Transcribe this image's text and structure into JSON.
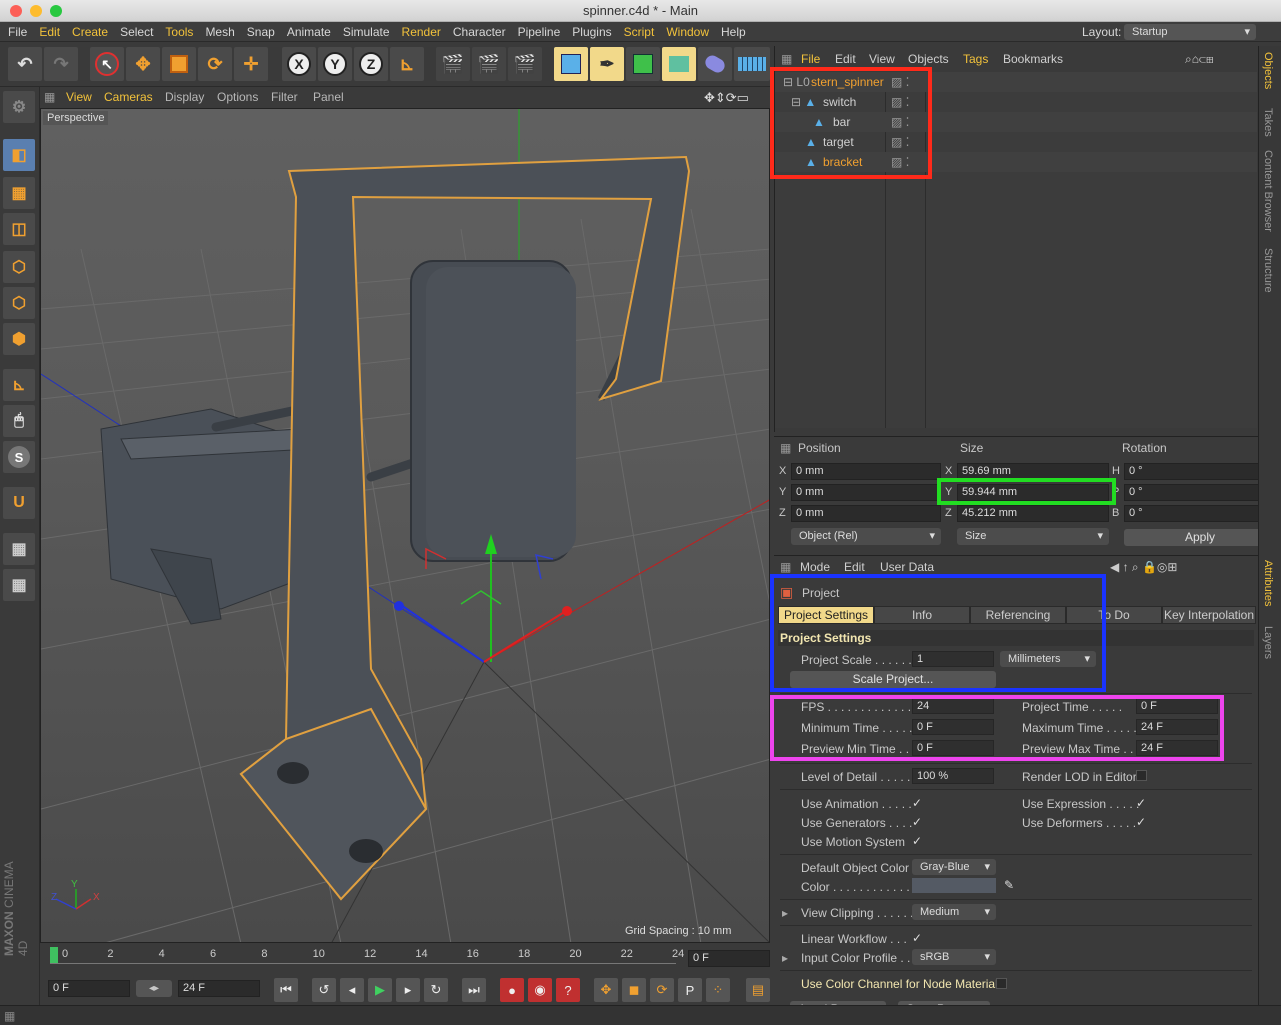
{
  "window": {
    "title": "spinner.c4d * - Main"
  },
  "menubar": {
    "items": [
      "File",
      "Edit",
      "Create",
      "Select",
      "Tools",
      "Mesh",
      "Snap",
      "Animate",
      "Simulate",
      "Render",
      "Character",
      "Pipeline",
      "Plugins",
      "Script",
      "Window",
      "Help"
    ],
    "layout_label": "Layout:",
    "layout_value": "Startup"
  },
  "viewport": {
    "menu": [
      "View",
      "Cameras",
      "Display",
      "Options",
      "Filter",
      "Panel"
    ],
    "camera_label": "Perspective",
    "grid_spacing": "Grid Spacing : 10 mm",
    "axis_x": "X",
    "axis_y": "Y",
    "axis_z": "Z"
  },
  "branding": {
    "maxon": "MAXON",
    "cinema": "CINEMA 4D"
  },
  "timeline": {
    "ticks": [
      "0",
      "2",
      "4",
      "6",
      "8",
      "10",
      "12",
      "14",
      "16",
      "18",
      "20",
      "22",
      "24"
    ],
    "current_frame": "0 F"
  },
  "transport": {
    "start_field": "0 F",
    "end_field": "24 F"
  },
  "objects_panel": {
    "menu": [
      "File",
      "Edit",
      "View",
      "Objects",
      "Tags",
      "Bookmarks"
    ],
    "items": [
      {
        "name": "stern_spinner",
        "indent": 0
      },
      {
        "name": "switch",
        "indent": 1
      },
      {
        "name": "bar",
        "indent": 2
      },
      {
        "name": "target",
        "indent": 1
      },
      {
        "name": "bracket",
        "indent": 1
      }
    ]
  },
  "coordinates": {
    "headers": {
      "position": "Position",
      "size": "Size",
      "rotation": "Rotation"
    },
    "position": {
      "x": "0 mm",
      "y": "0 mm",
      "z": "0 mm"
    },
    "size": {
      "x": "59.69 mm",
      "y": "59.944 mm",
      "z": "45.212 mm"
    },
    "rotation": {
      "h": "0 °",
      "p": "0 °",
      "b": "0 °"
    },
    "labels": {
      "x": "X",
      "y": "Y",
      "z": "Z",
      "h": "H",
      "p": "P",
      "b": "B"
    },
    "mode_dropdown": "Object (Rel)",
    "size_dropdown": "Size",
    "apply_label": "Apply"
  },
  "attributes": {
    "menu": [
      "Mode",
      "Edit",
      "User Data"
    ],
    "object_label": "Project",
    "tabs": [
      "Project Settings",
      "Info",
      "Referencing",
      "To Do",
      "Key Interpolation"
    ],
    "section_title": "Project Settings",
    "project_scale_label": "Project Scale . . . . . .",
    "project_scale_value": "1",
    "project_scale_unit": "Millimeters",
    "scale_project_button": "Scale Project...",
    "fps_label": "FPS . . . . . . . . . . . . . .",
    "fps_value": "24",
    "project_time_label": "Project Time . . . . .",
    "project_time_value": "0 F",
    "min_time_label": "Minimum Time . . . . .",
    "min_time_value": "0 F",
    "max_time_label": "Maximum Time . . . . .",
    "max_time_value": "24 F",
    "preview_min_label": "Preview Min Time . .",
    "preview_min_value": "0 F",
    "preview_max_label": "Preview Max Time . . .",
    "preview_max_value": "24 F",
    "lod_label": "Level of Detail . . . . .",
    "lod_value": "100 %",
    "render_lod_label": "Render LOD in Editor",
    "use_animation_label": "Use Animation . . . . .",
    "use_expression_label": "Use Expression . . . . .",
    "use_generators_label": "Use Generators . . . .",
    "use_deformers_label": "Use Deformers . . . . .",
    "use_motion_label": "Use Motion System",
    "default_color_label": "Default Object Color",
    "default_color_value": "Gray-Blue",
    "color_label": "Color . . . . . . . . . . . .",
    "view_clipping_label": "View Clipping . . . . . .",
    "view_clipping_value": "Medium",
    "linear_workflow_label": "Linear Workflow . . .",
    "input_color_label": "Input Color Profile . .",
    "input_color_value": "sRGB",
    "node_material_label": "Use Color Channel for Node Material",
    "load_preset": "Load Preset...",
    "save_preset": "Save Preset..."
  },
  "right_tabs": {
    "top": [
      "Objects",
      "Takes",
      "Content Browser",
      "Structure"
    ],
    "bottom": [
      "Attributes",
      "Layers"
    ]
  },
  "colors": {
    "accent": "#f2c23b",
    "selected": "#f0a030",
    "red_box": "#ff2a1a",
    "green_box": "#22dd22",
    "blue_box": "#1a33ff",
    "magenta_box": "#ee44ee"
  }
}
